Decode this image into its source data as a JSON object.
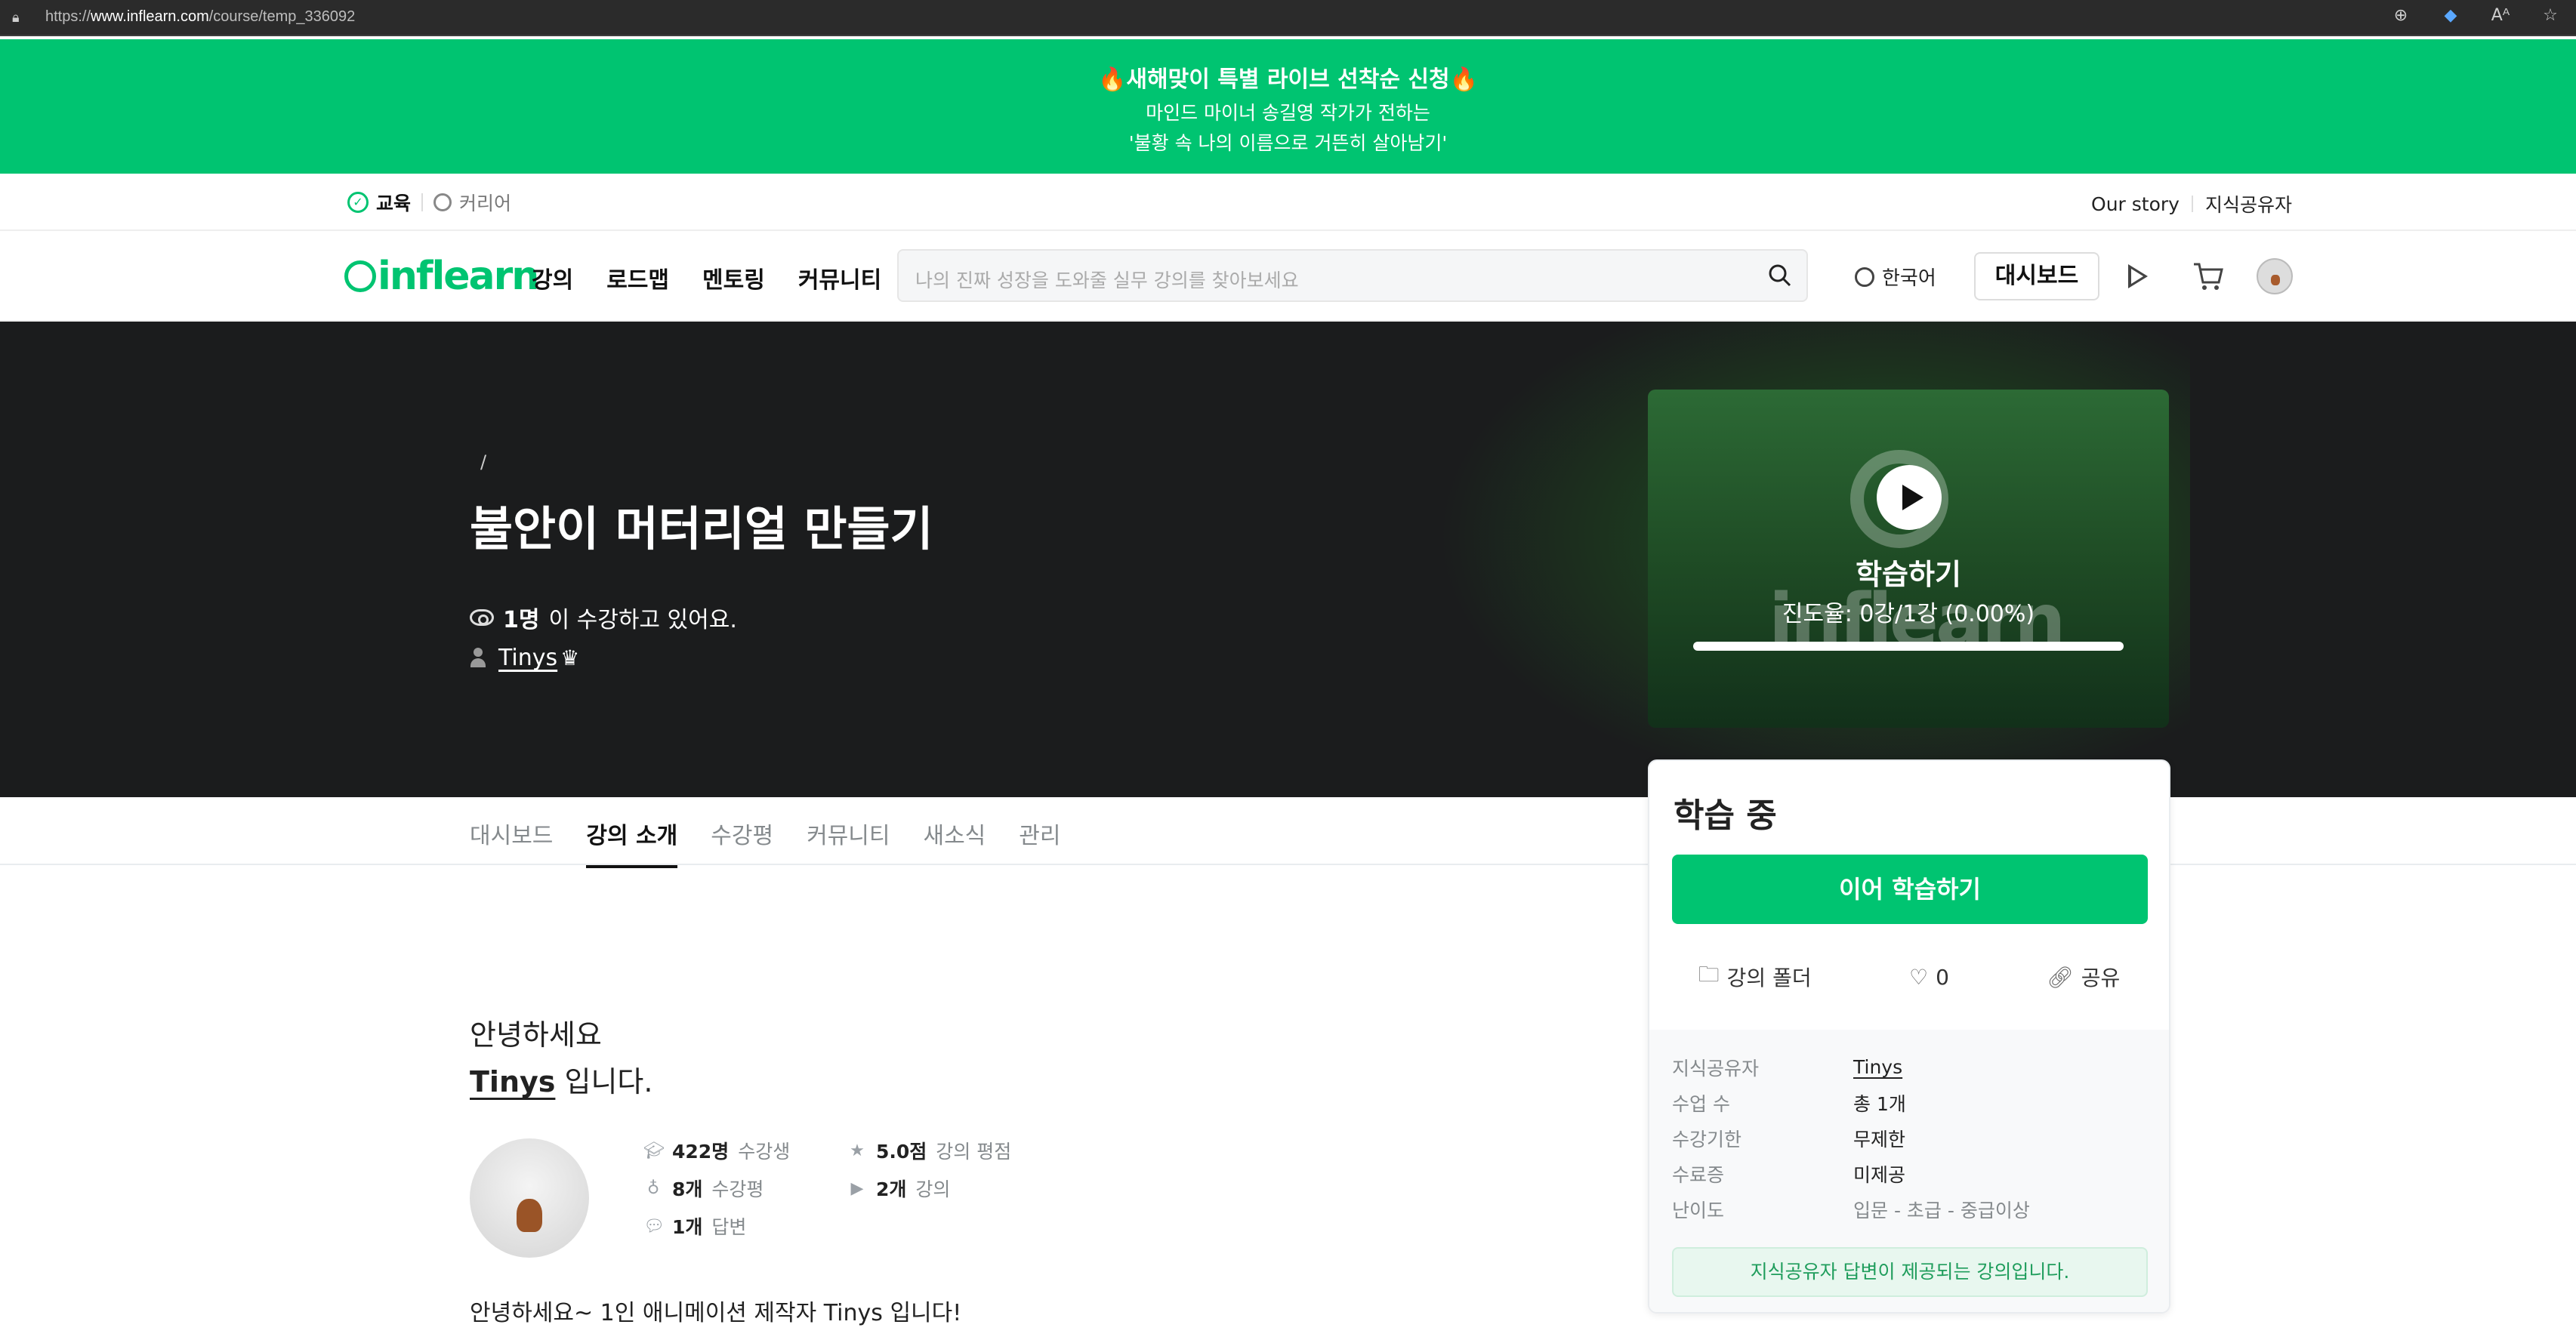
{
  "browser": {
    "url_prefix": "https://",
    "url_host": "www.inflearn.com",
    "url_path": "/course/temp_336092"
  },
  "promo": {
    "title": "🔥새해맞이 특별 라이브 선착순 신청🔥",
    "line1": "마인드 마이너 송길영 작가가 전하는",
    "line2": "'불황 속 나의 이름으로 거뜬히 살아남기'"
  },
  "topnav": {
    "edu": "교육",
    "career": "커리어",
    "our_story": "Our story",
    "instructor": "지식공유자"
  },
  "mainnav": {
    "logo": "inflearn",
    "menu": [
      "강의",
      "로드맵",
      "멘토링",
      "커뮤니티"
    ],
    "search_placeholder": "나의 진짜 성장을 도와줄 실무 강의를 찾아보세요",
    "language": "한국어",
    "dashboard": "대시보드"
  },
  "hero": {
    "breadcrumb": "/",
    "title": "불안이 머터리얼 만들기",
    "viewers_count": "1명",
    "viewers_text": "이 수강하고 있어요.",
    "author": "Tinys",
    "crown": "♛"
  },
  "video": {
    "learn_label": "학습하기",
    "progress": "진도율: 0강/1강 (0.00%)",
    "watermark": "inflearn",
    "progress_fraction": 0
  },
  "tabs": [
    "대시보드",
    "강의 소개",
    "수강평",
    "커뮤니티",
    "새소식",
    "관리"
  ],
  "active_tab": 1,
  "sidebar": {
    "status": "학습 중",
    "continue": "이어 학습하기",
    "folder": "강의 폴더",
    "likes": "0",
    "share": "공유",
    "info": [
      {
        "k": "지식공유자",
        "v": "Tinys"
      },
      {
        "k": "수업 수",
        "v": "총 1개"
      },
      {
        "k": "수강기한",
        "v": "무제한"
      },
      {
        "k": "수료증",
        "v": "미제공"
      },
      {
        "k": "난이도",
        "v": "입문 - 초급 - 중급이상"
      }
    ],
    "note": "지식공유자 답변이 제공되는 강의입니다."
  },
  "intro": {
    "greeting": "안녕하세요",
    "name": "Tinys",
    "suffix": "입니다."
  },
  "stats": [
    {
      "icon": "graduation-cap-icon",
      "value": "422명",
      "label": "수강생"
    },
    {
      "icon": "star-icon",
      "value": "5.0점",
      "label": "강의 평점"
    },
    {
      "icon": "medal-icon",
      "value": "8개",
      "label": "수강평"
    },
    {
      "icon": "play-circle-icon",
      "value": "2개",
      "label": "강의"
    },
    {
      "icon": "chat-bubbles-icon",
      "value": "1개",
      "label": "답변"
    }
  ],
  "bio": "안녕하세요~ 1인 애니메이션 제작자 Tinys 입니다!",
  "colors": {
    "brand": "#00c471",
    "hero_bg": "#1b1c1d"
  }
}
